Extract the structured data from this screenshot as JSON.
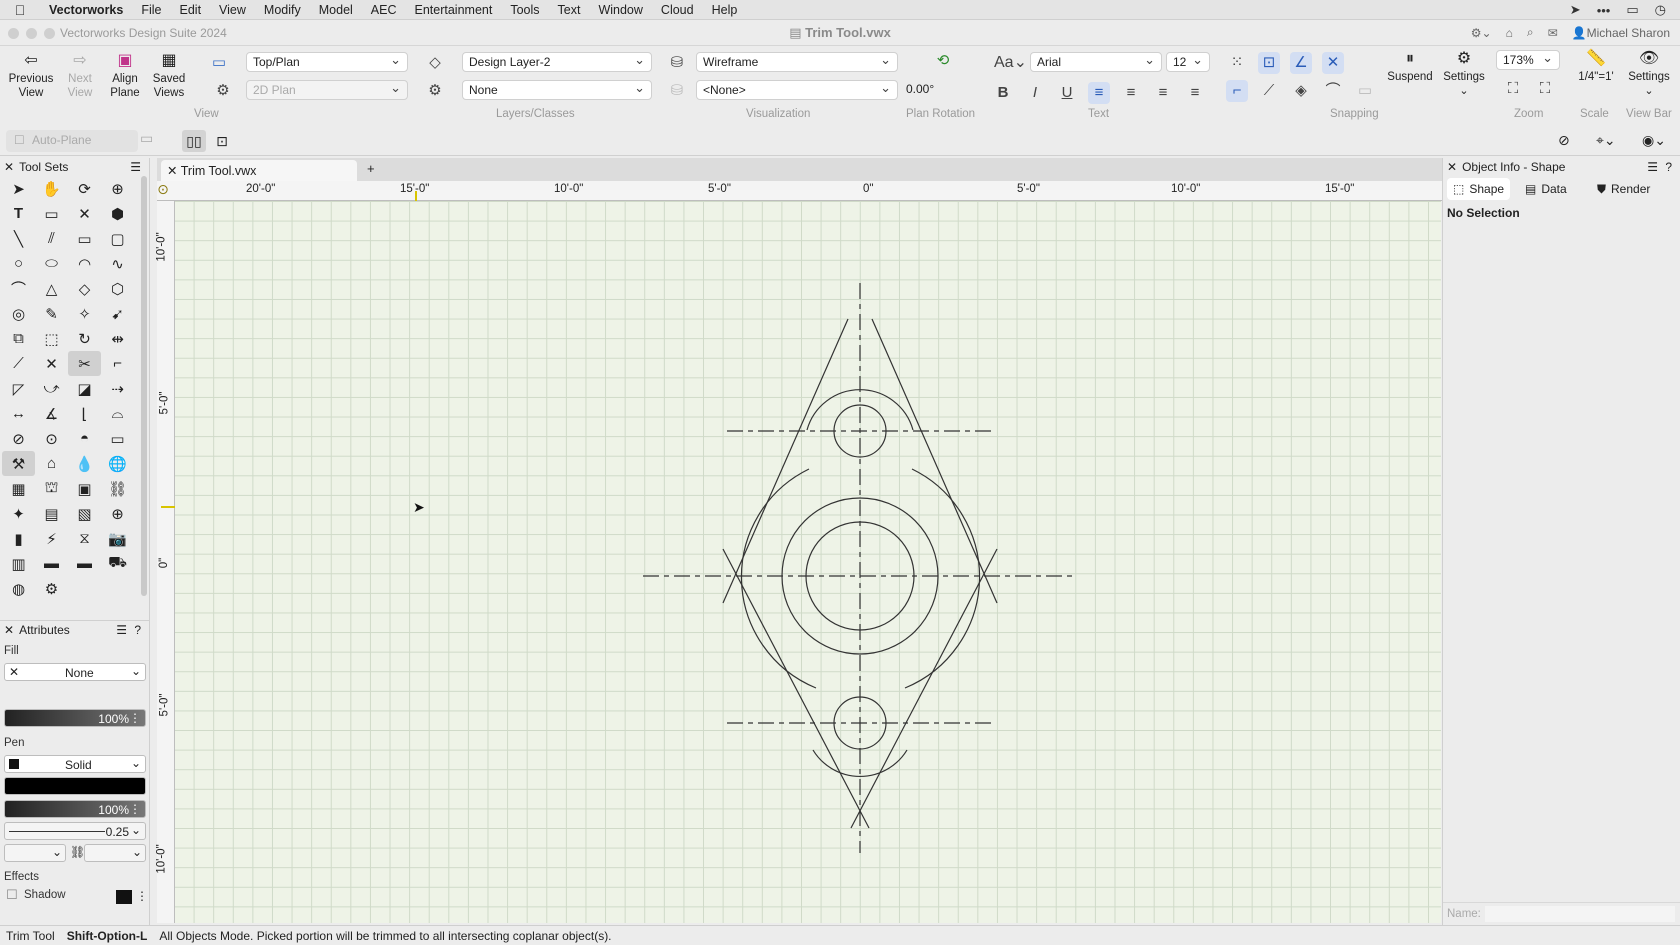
{
  "menubar": {
    "app_name": "Vectorworks",
    "items": [
      "File",
      "Edit",
      "View",
      "Modify",
      "Model",
      "AEC",
      "Entertainment",
      "Tools",
      "Text",
      "Window",
      "Cloud",
      "Help"
    ]
  },
  "titlebar": {
    "app_title": "Vectorworks Design Suite 2024",
    "doc_title": "Trim Tool.vwx",
    "user": "Michael Sharon"
  },
  "toolbar": {
    "previous_view": "Previous\nView",
    "next_view": "Next\nView",
    "align_plane": "Align\nPlane",
    "saved_views": "Saved\nViews",
    "view_select": "Top/Plan",
    "view_2d": "2D Plan",
    "group_view": "View",
    "layer_select": "Design Layer-2",
    "class_select": "None",
    "group_layers": "Layers/Classes",
    "render_mode": "Wireframe",
    "render_style": "<None>",
    "group_visualization": "Visualization",
    "plan_rotation_value": "0.00°",
    "group_plan_rotation": "Plan Rotation",
    "font_select": "Arial",
    "font_size": "12",
    "group_text": "Text",
    "group_snapping": "Snapping",
    "suspend_label": "Suspend",
    "settings_label": "Settings",
    "zoom_value": "173%",
    "group_zoom": "Zoom",
    "scale_value": "1/4\"=1'",
    "group_scale": "Scale",
    "viewbar_settings": "Settings",
    "group_viewbar": "View Bar"
  },
  "modebar": {
    "auto_plane": "Auto-Plane"
  },
  "toolsets": {
    "title": "Tool Sets"
  },
  "attributes": {
    "title": "Attributes",
    "fill_label": "Fill",
    "fill_value": "None",
    "fill_opacity": "100%",
    "pen_label": "Pen",
    "pen_value": "Solid",
    "pen_opacity": "100%",
    "line_weight": "0.25",
    "effects_label": "Effects",
    "shadow_label": "Shadow"
  },
  "document": {
    "tab_title": "Trim Tool.vwx",
    "add_tab": "+"
  },
  "rulers": {
    "horizontal": [
      "20'-0\"",
      "15'-0\"",
      "10'-0\"",
      "5'-0\"",
      "0\"",
      "5'-0\"",
      "10'-0\"",
      "15'-0\""
    ],
    "vertical": [
      "10'-0\"",
      "5'-0\"",
      "0\"",
      "5'-0\"",
      "10'-0\""
    ]
  },
  "object_info": {
    "title": "Object Info - Shape",
    "tabs": [
      "Shape",
      "Data",
      "Render"
    ],
    "selection": "No Selection",
    "name_label": "Name:"
  },
  "status": {
    "tool": "Trim Tool",
    "shortcut": "Shift-Option-L",
    "hint": "All Objects Mode. Picked portion will be trimmed to all intersecting coplanar object(s)."
  },
  "colors": {
    "canvas": "#eef3e7",
    "grid": "#cfdac8",
    "accent": "#2a5cb8"
  }
}
